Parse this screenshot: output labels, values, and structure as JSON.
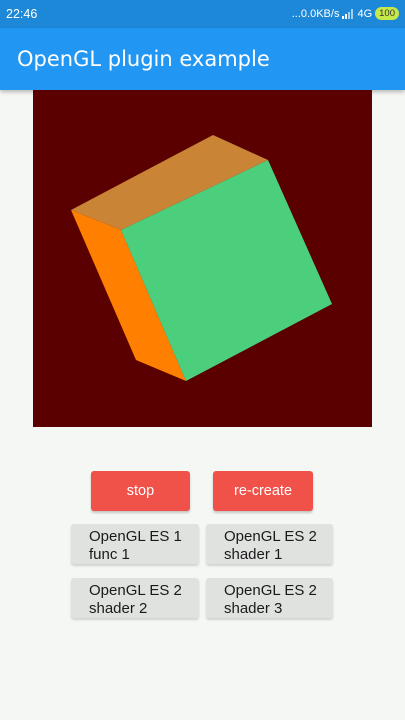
{
  "status_bar": {
    "time": "22:46",
    "network": "...0.0KB/s",
    "signal_icon": "signal-bars-icon",
    "network_type": "4G",
    "battery": "100"
  },
  "app_bar": {
    "title": "OpenGL plugin example"
  },
  "gl_view": {
    "background": "#5a0000",
    "cube_faces": {
      "front": "#4ccf7d",
      "top": "#c98436",
      "side": "#ff8000"
    }
  },
  "controls": {
    "stop_label": "stop",
    "recreate_label": "re-create"
  },
  "examples": [
    {
      "line1": "OpenGL ES 1",
      "line2": "func 1"
    },
    {
      "line1": "OpenGL ES 2",
      "line2": "shader 1"
    },
    {
      "line1": "OpenGL ES 2",
      "line2": "shader 2"
    },
    {
      "line1": "OpenGL ES 2",
      "line2": "shader 3"
    }
  ]
}
